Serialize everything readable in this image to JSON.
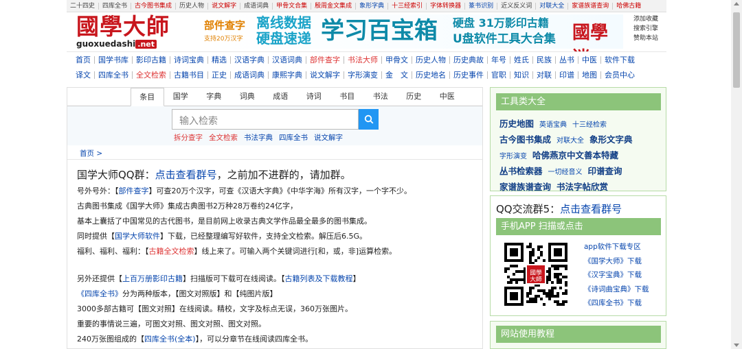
{
  "topbar": [
    "二十四史",
    "四库全书",
    "古今图书集成",
    "历史人物",
    "说文解字",
    "成语词典",
    "甲骨文合集",
    "殷周金文集成",
    "象形字典",
    "十三经索引",
    "字体转换器",
    "篆书识别",
    "近义反义词",
    "对联大全",
    "家谱族谱查询",
    "哈佛古籍"
  ],
  "logo": {
    "text": "國學大師",
    "domain": "guoxuedashi",
    "tld": ".net"
  },
  "ad": {
    "a1": "部件查字",
    "a2": "支持20万汉字",
    "a3a": "离线数据",
    "a3b": "硬盘速递",
    "a4": "学习百宝箱",
    "a5": "硬盘 31万影印古籍",
    "a6": "U盘软件工具大合集",
    "a7": "國學迷"
  },
  "sidelinks": [
    "添加收藏",
    "搜索引擎",
    "赞助本站"
  ],
  "nav1": [
    "首页",
    "国学书库",
    "影印古籍",
    "诗词宝典",
    "精选",
    "汉语字典",
    "汉语词典",
    "部件查字",
    "书法大师",
    "甲骨文",
    "历史人物",
    "历史典故",
    "年号",
    "姓氏",
    "民族",
    "丛书",
    "中医",
    "软件下载"
  ],
  "nav2": [
    "译文",
    "四库全书",
    "全文检索",
    "古籍书目",
    "正史",
    "成语词典",
    "康熙字典",
    "说文解字",
    "字形演变",
    "金　文",
    "历史地名",
    "历史事件",
    "官职",
    "知识",
    "对联",
    "印谱",
    "地图",
    "会员中心"
  ],
  "tabs": [
    "条目",
    "国学",
    "字典",
    "词典",
    "成语",
    "诗词",
    "书目",
    "书法",
    "历史",
    "中医"
  ],
  "search": {
    "placeholder": "输入检索"
  },
  "quick": [
    "拆分查字",
    "全文检索",
    "书法字典",
    "四库全书",
    "说文解字"
  ],
  "crumb": "首页 >",
  "content": {
    "h_pre": "国学大师QQ群：",
    "h_link": "点击查看群号",
    "h_post": "，之前加不进群的，请加群。",
    "l1a": "号外号外：【",
    "l1b": "部件查字",
    "l1c": "】可查20万个汉字，可查《汉语大字典》《中华字海》所有汉字，一个字不少。",
    "l2": "古典图书集成《国学大师》集成古典图书2万种28万卷约24亿字，",
    "l3": "基本上囊括了中国常见的古代图书，是目前网上收录古典文学作品最全最多的图书集成。",
    "l4a": "同时提供【",
    "l4b": "国学大师软件",
    "l4c": "】下载，已经整理编写好软件，支持全文检索。解压后6.5G。",
    "l5a": "福利、福利、福利：【",
    "l5b": "古籍全文检索",
    "l5c": "】线上来了。可输入两个关键词进行[和，或，非]运算检索。",
    "l6a": "另外还提供【",
    "l6b": "上百万册影印古籍",
    "l6c": "】扫描版可下载可在线阅读。【",
    "l6d": "古籍列表及下载教程",
    "l6e": "】",
    "l7a": "《四库全书》",
    "l7b": "分为两种版本，【图文对照版】和【纯图片版】",
    "l8": "3000多部古籍可【图文对照】在线阅读。精校，文字及标点无误，360万张图片。",
    "l9": "重要的事情说三遍，可图文对照、图文对照、图文对照。",
    "l10a": "240万张图组成的【",
    "l10b": "四库全书(全本)",
    "l10c": "】，可以分章节在线阅读四库全书。"
  },
  "side": {
    "tools_title": "工具类大全",
    "tools": [
      {
        "t": "历史地图",
        "c": "b"
      },
      {
        "t": "英语宝典",
        "c": "s"
      },
      {
        "t": "十三经检索",
        "c": "s"
      },
      {
        "t": "古今图书集成",
        "c": "b"
      },
      {
        "t": "对联大全",
        "c": "s"
      },
      {
        "t": "象形文字典",
        "c": "b"
      },
      {
        "t": "字形演变",
        "c": "s"
      },
      {
        "t": "哈佛燕京中文善本特藏",
        "c": "b"
      },
      {
        "t": "丛书检索器",
        "c": "b"
      },
      {
        "t": "一切经音义",
        "c": "s"
      },
      {
        "t": "印谱查询",
        "c": "b"
      },
      {
        "t": "家谱族谱查询",
        "c": "b"
      },
      {
        "t": "书法字帖欣赏",
        "c": "b"
      }
    ],
    "qq_pre": "QQ交流群5：",
    "qq_link": "点击查看群号",
    "app_title": "手机APP 扫描或点击",
    "app_links": [
      "app软件下载专区",
      "《国学大师》下载",
      "《汉字宝典》下载",
      "《诗词曲宝典》下载",
      "《四库全书》下载"
    ],
    "usage_title": "网站使用教程"
  },
  "colors": {
    "brand": "#c8161d",
    "link": "#0645ad",
    "green": "#8cc47a",
    "search_btn": "#2196f3"
  }
}
